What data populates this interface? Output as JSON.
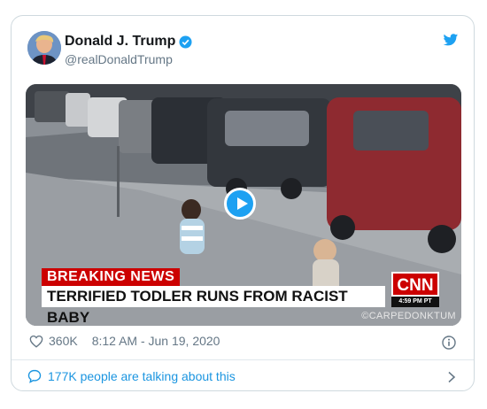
{
  "tweet": {
    "display_name": "Donald J. Trump",
    "handle": "@realDonaldTrump",
    "likes": "360K",
    "timestamp": "8:12 AM - Jun 19, 2020",
    "talking": "177K people are talking about this"
  },
  "video": {
    "breaking_label": "BREAKING NEWS",
    "headline": "TERRIFIED TODLER RUNS FROM RACIST BABY",
    "network_logo": "CNN",
    "network_time": "4:59 PM PT",
    "watermark": "©CARPEDONKTUM"
  },
  "colors": {
    "accent": "#1da1f2",
    "link": "#1b95e0",
    "muted": "#657786",
    "breaking_red": "#cc0000"
  },
  "icons": [
    "avatar",
    "verified-badge-icon",
    "twitter-bird-icon",
    "play-icon",
    "heart-icon",
    "info-icon",
    "speech-bubble-icon",
    "chevron-right-icon"
  ]
}
